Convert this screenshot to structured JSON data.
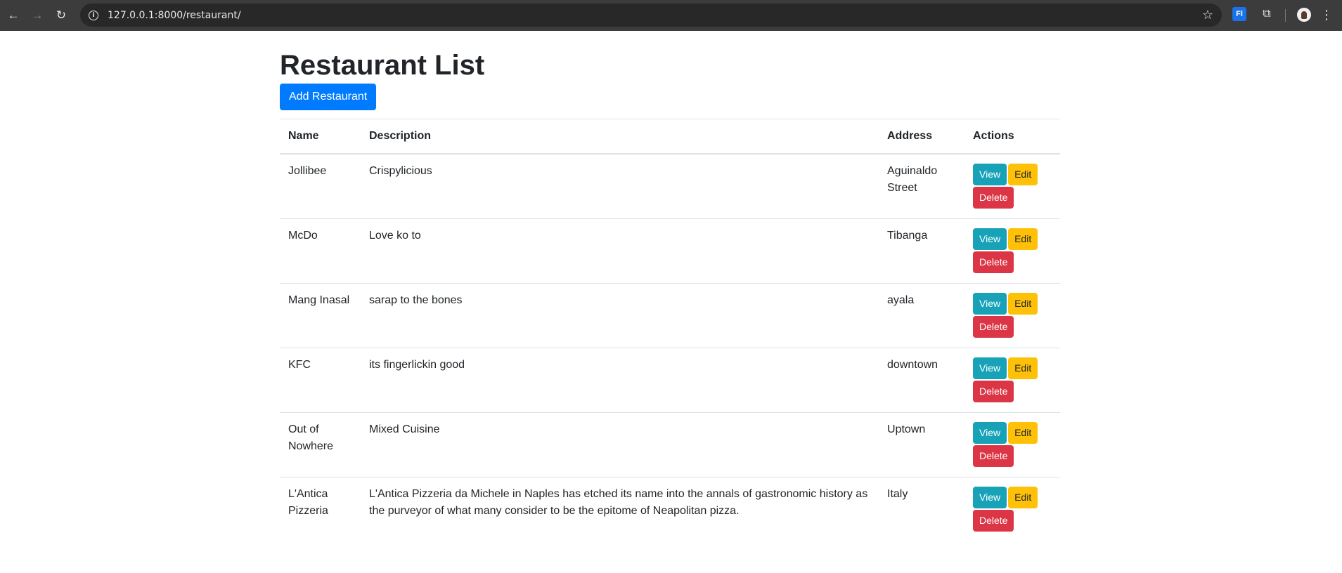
{
  "browser": {
    "url": "127.0.0.1:8000/restaurant/",
    "icons": {
      "back": "back-arrow-icon",
      "forward": "forward-arrow-icon",
      "reload": "reload-icon",
      "site_info": "info-icon",
      "bookmark": "star-icon",
      "extension_translate": "translate-extension-icon",
      "extensions": "puzzle-icon",
      "profile": "avatar",
      "menu": "kebab-menu-icon"
    },
    "site_info_glyph": "i",
    "translate_glyph": "Fl"
  },
  "page": {
    "title": "Restaurant List",
    "add_button": "Add Restaurant"
  },
  "table": {
    "headers": [
      "Name",
      "Description",
      "Address",
      "Actions"
    ],
    "action_labels": {
      "view": "View",
      "edit": "Edit",
      "delete": "Delete"
    },
    "rows": [
      {
        "name": "Jollibee",
        "description": "Crispylicious",
        "address": "Aguinaldo Street"
      },
      {
        "name": "McDo",
        "description": "Love ko to",
        "address": "Tibanga"
      },
      {
        "name": "Mang Inasal",
        "description": "sarap to the bones",
        "address": "ayala"
      },
      {
        "name": "KFC",
        "description": "its fingerlickin good",
        "address": "downtown"
      },
      {
        "name": "Out of Nowhere",
        "description": "Mixed Cuisine",
        "address": "Uptown"
      },
      {
        "name": "L'Antica Pizzeria",
        "description": "L'Antica Pizzeria da Michele in Naples has etched its name into the annals of gastronomic history as the purveyor of what many consider to be the epitome of Neapolitan pizza.",
        "address": "Italy"
      }
    ]
  },
  "colors": {
    "primary": "#007bff",
    "info": "#17a2b8",
    "warning": "#ffc107",
    "danger": "#dc3545"
  }
}
